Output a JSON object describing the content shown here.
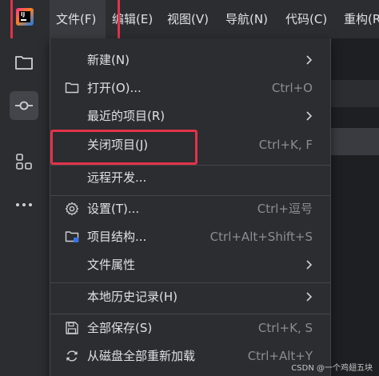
{
  "menubar": {
    "items": [
      {
        "label": "文件(F)"
      },
      {
        "label": "编辑(E)"
      },
      {
        "label": "视图(V)"
      },
      {
        "label": "导航(N)"
      },
      {
        "label": "代码(C)"
      },
      {
        "label": "重构(R)"
      }
    ]
  },
  "app": {
    "logo_text": "IJ"
  },
  "dropdown": {
    "items": [
      {
        "label": "新建(N)",
        "shortcut": ""
      },
      {
        "label": "打开(O)...",
        "shortcut": "Ctrl+O"
      },
      {
        "label": "最近的项目(R)",
        "shortcut": ""
      },
      {
        "label": "关闭项目(J)",
        "shortcut": "Ctrl+K, F"
      },
      {
        "label": "远程开发...",
        "shortcut": ""
      },
      {
        "label": "设置(T)...",
        "shortcut": "Ctrl+逗号"
      },
      {
        "label": "项目结构...",
        "shortcut": "Ctrl+Alt+Shift+S"
      },
      {
        "label": "文件属性",
        "shortcut": ""
      },
      {
        "label": "本地历史记录(H)",
        "shortcut": ""
      },
      {
        "label": "全部保存(S)",
        "shortcut": "Ctrl+K, S"
      },
      {
        "label": "从磁盘全部重新加载",
        "shortcut": "Ctrl+Alt+Y"
      }
    ]
  },
  "watermark": "CSDN @一个鸡翅五块",
  "colors": {
    "background": "#2b2d30",
    "highlight_border": "#e3324a",
    "text": "#dfe1e5",
    "shortcut_text": "#8a8d93"
  }
}
